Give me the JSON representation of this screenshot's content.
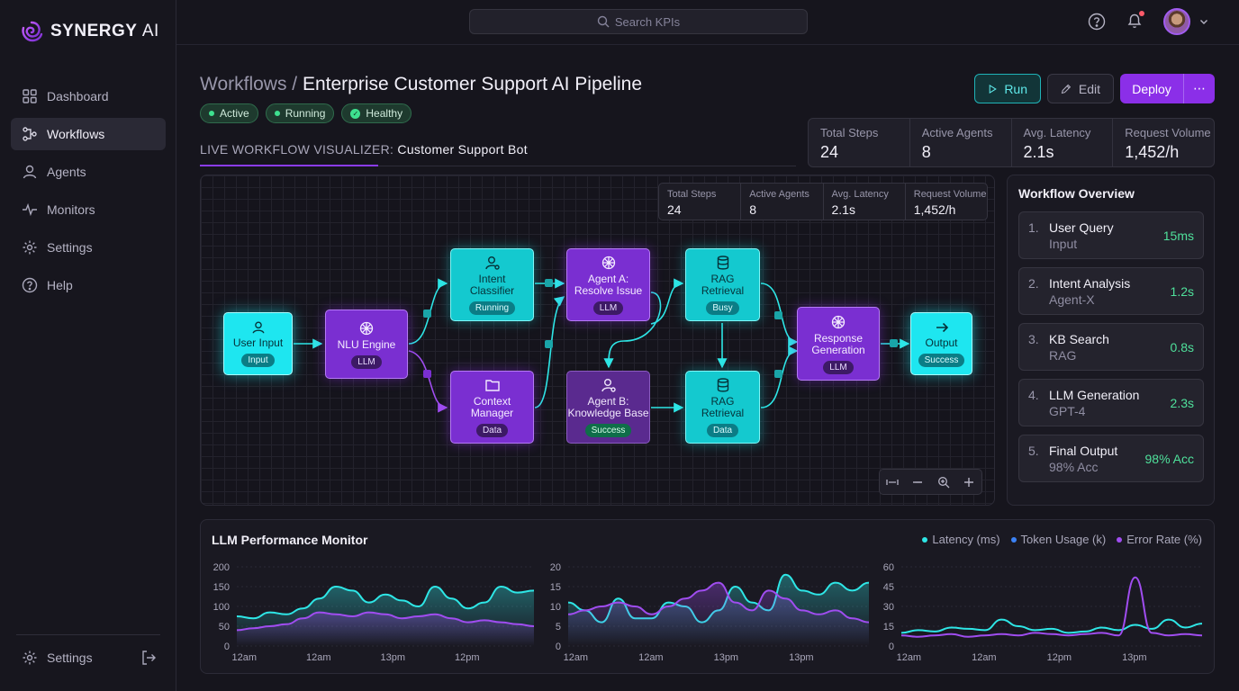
{
  "app": {
    "brand_bold": "SYNERGY",
    "brand_light": "AI"
  },
  "sidebar": {
    "items": [
      {
        "label": "Dashboard",
        "icon": "grid-icon"
      },
      {
        "label": "Workflows",
        "icon": "workflow-icon",
        "active": true
      },
      {
        "label": "Agents",
        "icon": "user-icon"
      },
      {
        "label": "Monitors",
        "icon": "pulse-icon"
      },
      {
        "label": "Settings",
        "icon": "gear-icon"
      },
      {
        "label": "Help",
        "icon": "help-icon"
      }
    ],
    "footer_label": "Settings"
  },
  "header": {
    "search_placeholder": "Search KPIs"
  },
  "page": {
    "crumb": "Workflows",
    "separator": " / ",
    "title": "Enterprise Customer Support AI Pipeline",
    "badges": [
      "Active",
      "Running",
      "Healthy"
    ],
    "live_prefix": "LIVE WORKFLOW VISUALIZER:",
    "live_name": "Customer Support Bot"
  },
  "actions": {
    "run": "Run",
    "edit": "Edit",
    "deploy": "Deploy",
    "more": "⋯"
  },
  "stats": [
    {
      "label": "Total Steps",
      "value": "24"
    },
    {
      "label": "Active Agents",
      "value": "8"
    },
    {
      "label": "Avg. Latency",
      "value": "2.1s"
    },
    {
      "label": "Request Volume",
      "value": "1,452/h"
    }
  ],
  "nodes": [
    {
      "id": "input",
      "title": [
        "User Input"
      ],
      "tag": "Input"
    },
    {
      "id": "nlu",
      "title": [
        "NLU Engine"
      ],
      "tag": "LLM"
    },
    {
      "id": "intent",
      "title": [
        "Intent",
        "Classifier"
      ],
      "tag": "Running"
    },
    {
      "id": "context",
      "title": [
        "Context",
        "Manager"
      ],
      "tag": "Data"
    },
    {
      "id": "agentA",
      "title": [
        "Agent A:",
        "Resolve Issue"
      ],
      "tag": "LLM"
    },
    {
      "id": "agentB",
      "title": [
        "Agent B:",
        "Knowledge Base"
      ],
      "tag": "Success"
    },
    {
      "id": "rag1",
      "title": [
        "RAG",
        "Retrieval"
      ],
      "tag": "Busy"
    },
    {
      "id": "rag2",
      "title": [
        "RAG",
        "Retrieval"
      ],
      "tag": "Data"
    },
    {
      "id": "response",
      "title": [
        "Response",
        "Generation"
      ],
      "tag": "LLM"
    },
    {
      "id": "output",
      "title": [
        "Output"
      ],
      "tag": "Success"
    }
  ],
  "overview": {
    "title": "Workflow Overview",
    "items": [
      {
        "num": "1.",
        "name": "User Query",
        "sub": "Input",
        "value": "15ms"
      },
      {
        "num": "2.",
        "name": "Intent Analysis",
        "sub": "Agent-X",
        "value": "1.2s"
      },
      {
        "num": "3.",
        "name": "KB Search",
        "sub": "RAG",
        "value": "0.8s"
      },
      {
        "num": "4.",
        "name": "LLM Generation",
        "sub": "GPT-4",
        "value": "2.3s"
      },
      {
        "num": "5.",
        "name": "Final Output",
        "sub": "98% Acc",
        "value": "98% Acc"
      }
    ]
  },
  "colors": {
    "cyan": "#2ee6e6",
    "blue": "#3b82f6",
    "purple": "#a04df0",
    "accent": "#8b2fe8",
    "success": "#4fe09b"
  },
  "chart_data": [
    {
      "type": "area",
      "title": "LLM Performance Monitor",
      "legend": [
        "Latency (ms)",
        "Token Usage (k)",
        "Error Rate (%)"
      ],
      "x": [
        "12am",
        "12am",
        "13pm",
        "12pm"
      ],
      "ylim": [
        0,
        200
      ],
      "yticks": [
        0,
        50,
        100,
        150,
        200
      ],
      "series": [
        {
          "name": "Latency (ms)",
          "values": [
            75,
            70,
            85,
            80,
            95,
            120,
            150,
            140,
            110,
            130,
            115,
            100,
            150,
            120,
            95,
            110,
            150,
            135,
            140
          ]
        },
        {
          "name": "Error Rate (%)",
          "values": [
            40,
            45,
            50,
            55,
            70,
            85,
            80,
            75,
            85,
            80,
            70,
            75,
            80,
            70,
            60,
            65,
            60,
            55,
            50
          ]
        }
      ]
    },
    {
      "type": "area",
      "x": [
        "12am",
        "12am",
        "13pm",
        "13pm"
      ],
      "ylim": [
        0,
        20
      ],
      "yticks": [
        0,
        5,
        10,
        15,
        20
      ],
      "series": [
        {
          "name": "Latency (ms)",
          "values": [
            11,
            9,
            6,
            12,
            7,
            7,
            11,
            10,
            6,
            9,
            15,
            11,
            9,
            18,
            14,
            13,
            16,
            14,
            16
          ]
        },
        {
          "name": "Error Rate (%)",
          "values": [
            8,
            9,
            10,
            11,
            10,
            8,
            10,
            12,
            14,
            16,
            11,
            9,
            14,
            12,
            9,
            8,
            9,
            7,
            6
          ]
        }
      ]
    },
    {
      "type": "line",
      "x": [
        "12am",
        "12am",
        "12pm",
        "13pm"
      ],
      "ylim": [
        0,
        60
      ],
      "yticks": [
        0,
        15,
        30,
        45,
        60
      ],
      "series": [
        {
          "name": "Latency (ms)",
          "values": [
            10,
            12,
            11,
            14,
            13,
            12,
            20,
            15,
            12,
            13,
            10,
            11,
            14,
            12,
            16,
            13,
            20,
            14,
            17
          ]
        },
        {
          "name": "Error Rate (%)",
          "values": [
            8,
            7,
            8,
            9,
            7,
            8,
            9,
            8,
            10,
            9,
            8,
            9,
            10,
            8,
            52,
            10,
            8,
            9,
            8
          ]
        }
      ]
    }
  ]
}
